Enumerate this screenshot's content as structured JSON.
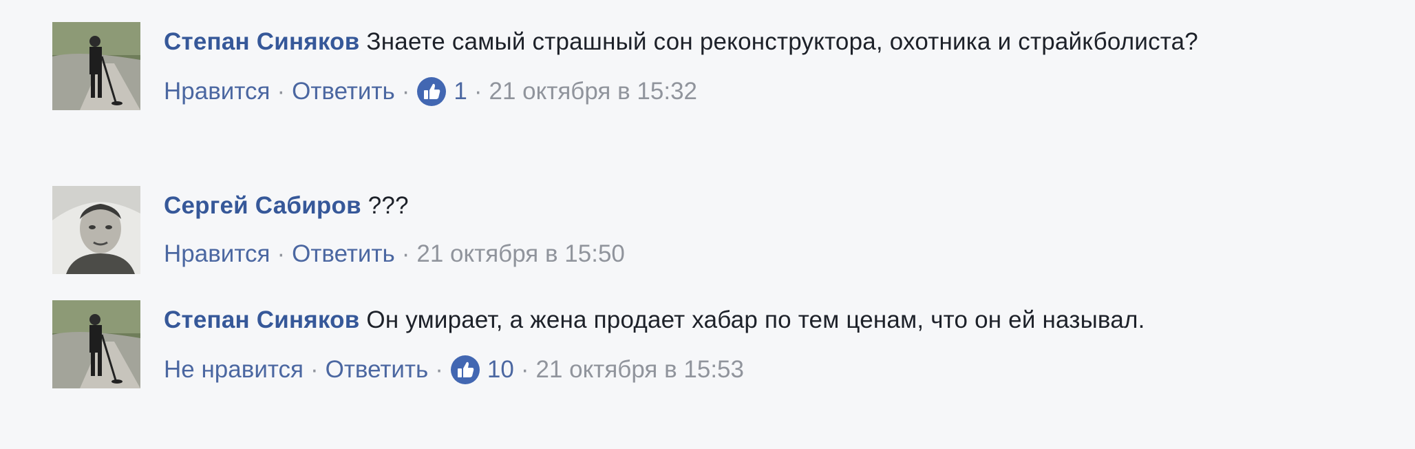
{
  "comments": [
    {
      "author": "Степан Синяков",
      "avatar": "avatar-man-with-metal-detector",
      "text": "Знаете самый страшный сон реконструктора, охотника и страйкболиста?",
      "actions": {
        "like": "Нравится",
        "reply": "Ответить",
        "like_count": "1",
        "timestamp": "21 октября в 15:32"
      }
    },
    {
      "author": "Сергей Сабиров",
      "avatar": "avatar-portrait-bw",
      "text": "???",
      "actions": {
        "like": "Нравится",
        "reply": "Ответить",
        "timestamp": "21 октября в 15:50"
      }
    },
    {
      "author": "Степан Синяков",
      "avatar": "avatar-man-with-metal-detector",
      "text": "Он умирает, а жена продает хабар по тем ценам, что он ей называл.",
      "actions": {
        "like": "Не нравится",
        "reply": "Ответить",
        "like_count": "10",
        "timestamp": "21 октября в 15:53"
      }
    }
  ],
  "colors": {
    "background": "#f6f7f9",
    "author": "#365899",
    "link": "#4b67a1",
    "meta": "#90949c",
    "like_badge": "#4267b2"
  },
  "icons": {
    "like_badge": "thumbs-up-icon"
  }
}
